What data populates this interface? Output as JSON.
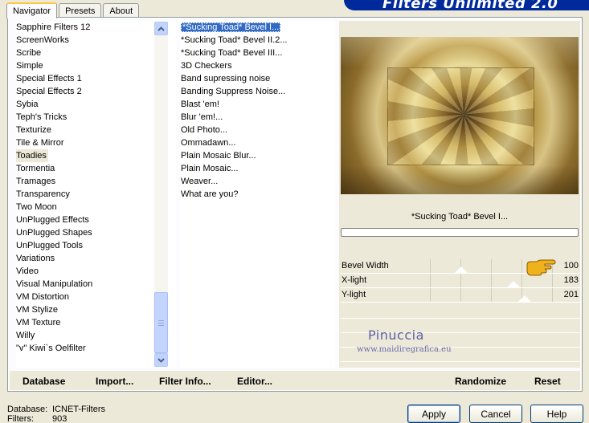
{
  "tabs": [
    "Navigator",
    "Presets",
    "About"
  ],
  "banner": "Filters Unlimited 2.0",
  "categories": [
    "Sapphire Filters 12",
    "ScreenWorks",
    "Scribe",
    "Simple",
    "Special Effects 1",
    "Special Effects 2",
    "Sybia",
    "Teph's Tricks",
    "Texturize",
    "Tile & Mirror",
    "Toadies",
    "Tormentia",
    "Tramages",
    "Transparency",
    "Two Moon",
    "UnPlugged Effects",
    "UnPlugged Shapes",
    "UnPlugged Tools",
    "Variations",
    "Video",
    "Visual Manipulation",
    "VM Distortion",
    "VM Stylize",
    "VM Texture",
    "Willy",
    "\"v\" Kiwi`s Oelfilter"
  ],
  "selected_category": "Toadies",
  "filters": [
    "*Sucking Toad*  Bevel I...",
    "*Sucking Toad*  Bevel II.2...",
    "*Sucking Toad*  Bevel III...",
    "3D Checkers",
    "Band supressing noise",
    "Banding Suppress Noise...",
    "Blast 'em!",
    "Blur 'em!...",
    "Old Photo...",
    "Ommadawn...",
    "Plain Mosaic Blur...",
    "Plain Mosaic...",
    "Weaver...",
    "What are you?"
  ],
  "selected_filter": "*Sucking Toad*  Bevel I...",
  "filter_title": "*Sucking Toad*  Bevel I...",
  "progress": 0,
  "params": [
    {
      "label": "Bevel Width",
      "value": "100",
      "level": 0.39
    },
    {
      "label": "X-light",
      "value": "183",
      "level": 0.72
    },
    {
      "label": "Y-light",
      "value": "201",
      "level": 0.79
    }
  ],
  "watermark": {
    "name": "Pinuccia",
    "url": "www.maidiregrafica.eu"
  },
  "bottom_buttons": {
    "database": "Database",
    "import": "Import...",
    "filter_info": "Filter Info...",
    "editor": "Editor...",
    "randomize": "Randomize",
    "reset": "Reset"
  },
  "status": {
    "database_label": "Database:",
    "database_value": "ICNET-Filters",
    "filters_label": "Filters:",
    "filters_value": "903"
  },
  "dialog_buttons": {
    "apply": "Apply",
    "cancel": "Cancel",
    "help": "Help"
  },
  "colors": {
    "selection": "#316ac5",
    "banner": "#002a9c",
    "dialog_bg": "#ece9d8"
  }
}
